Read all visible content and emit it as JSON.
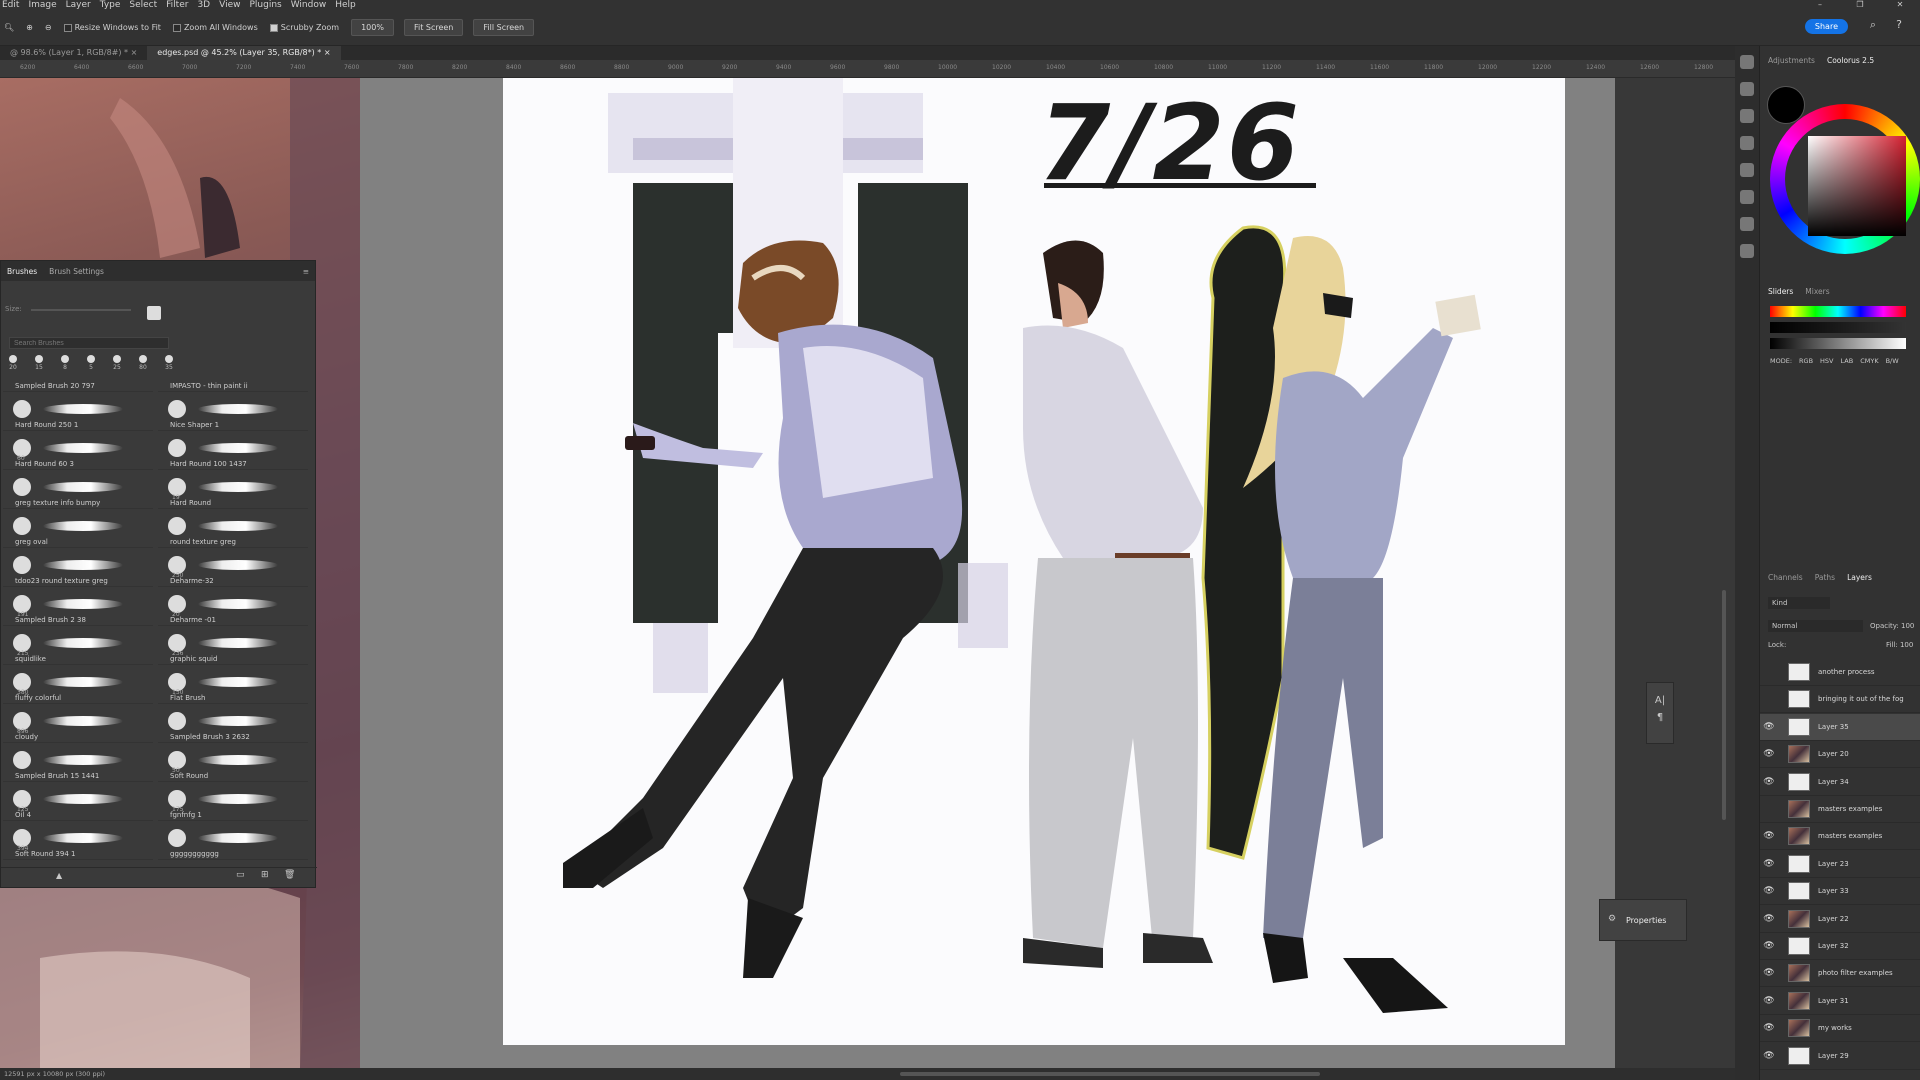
{
  "menubar": {
    "items": [
      "Edit",
      "Image",
      "Layer",
      "Type",
      "Select",
      "Filter",
      "3D",
      "View",
      "Plugins",
      "Window",
      "Help"
    ],
    "window_controls": [
      "–",
      "❐",
      "✕"
    ]
  },
  "options": {
    "resize_windows": "Resize Windows to Fit",
    "zoom_all": "Zoom All Windows",
    "scrubby_zoom": "Scrubby Zoom",
    "zoom_value": "100%",
    "fit_screen": "Fit Screen",
    "fill_screen": "Fill Screen",
    "share": "Share"
  },
  "tabs": [
    {
      "label": "@ 98.6% (Layer 1, RGB/8#) *",
      "close": "×"
    },
    {
      "label": "edges.psd @ 45.2% (Layer 35, RGB/8*) *",
      "close": "×"
    }
  ],
  "ruler": [
    "6200",
    "6400",
    "6600",
    "7000",
    "7200",
    "7400",
    "7600",
    "7800",
    "8200",
    "8400",
    "8600",
    "8800",
    "9000",
    "9200",
    "9400",
    "9600",
    "9800",
    "10000",
    "10200",
    "10400",
    "10600",
    "10800",
    "11000",
    "11200",
    "11400",
    "11600",
    "11800",
    "12000",
    "12200",
    "12400",
    "12600",
    "12800"
  ],
  "artwork": {
    "date": "7/26"
  },
  "brushes": {
    "tabs": [
      "Brushes",
      "Brush Settings"
    ],
    "search_placeholder": "Search Brushes",
    "size_label": "Size:",
    "preset_sizes": [
      "20",
      "15",
      "8",
      "5",
      "25",
      "80",
      "35"
    ],
    "items": [
      {
        "name": "Sampled Brush 20 797",
        "size": ""
      },
      {
        "name": "IMPASTO - thin paint ii",
        "size": ""
      },
      {
        "name": "Hard Round 250 1",
        "size": ""
      },
      {
        "name": "Nice Shaper 1",
        "size": ""
      },
      {
        "name": "Hard Round 60 3",
        "size": "60"
      },
      {
        "name": "Hard Round 100 1437",
        "size": ""
      },
      {
        "name": "greg texture info bumpy",
        "size": ""
      },
      {
        "name": "Hard Round",
        "size": "19"
      },
      {
        "name": "greg oval",
        "size": ""
      },
      {
        "name": "round texture greg",
        "size": ""
      },
      {
        "name": "tdoo23 round texture greg",
        "size": ""
      },
      {
        "name": "Deharme-32",
        "size": "250"
      },
      {
        "name": "Sampled Brush 2 38",
        "size": "191"
      },
      {
        "name": "Deharme -01",
        "size": "20"
      },
      {
        "name": "squidlike",
        "size": "215"
      },
      {
        "name": "graphic squid",
        "size": "236"
      },
      {
        "name": "fluffy colorful",
        "size": "380"
      },
      {
        "name": "Flat Brush",
        "size": "150"
      },
      {
        "name": "cloudy",
        "size": "896"
      },
      {
        "name": "Sampled Brush 3 2632",
        "size": ""
      },
      {
        "name": "Sampled Brush 15 1441",
        "size": ""
      },
      {
        "name": "Soft Round",
        "size": "50"
      },
      {
        "name": "Oil 4",
        "size": "125"
      },
      {
        "name": "fgnfnfg 1",
        "size": "175"
      },
      {
        "name": "Soft Round 394 1",
        "size": "394"
      },
      {
        "name": "ggggggggggg",
        "size": ""
      }
    ]
  },
  "right_panel": {
    "top_tabs": [
      "Adjustments",
      "Coolorus 2.5"
    ],
    "slider_tabs": [
      "Sliders",
      "Mixers"
    ],
    "modes": [
      "MODE:",
      "RGB",
      "HSV",
      "LAB",
      "CMYK",
      "B/W"
    ],
    "layer_tabs": [
      "Channels",
      "Paths",
      "Layers"
    ],
    "kind": "Kind",
    "blend_mode": "Normal",
    "opacity_label": "Opacity:",
    "opacity_value": "100",
    "lock_label": "Lock:",
    "fill_label": "Fill:",
    "fill_value": "100",
    "layers": [
      {
        "name": "another process",
        "visible": false,
        "thumb": "blank"
      },
      {
        "name": "bringing it out of the fog",
        "visible": false,
        "thumb": "blank"
      },
      {
        "name": "Layer 35",
        "visible": true,
        "thumb": "blank",
        "selected": true
      },
      {
        "name": "Layer 20",
        "visible": true,
        "thumb": "pic"
      },
      {
        "name": "Layer 34",
        "visible": true,
        "thumb": "blank"
      },
      {
        "name": "masters examples",
        "visible": false,
        "thumb": "pic"
      },
      {
        "name": "masters examples",
        "visible": true,
        "thumb": "pic"
      },
      {
        "name": "Layer 23",
        "visible": true,
        "thumb": "blank"
      },
      {
        "name": "Layer 33",
        "visible": true,
        "thumb": "blank"
      },
      {
        "name": "Layer 22",
        "visible": true,
        "thumb": "pic"
      },
      {
        "name": "Layer 32",
        "visible": true,
        "thumb": "blank"
      },
      {
        "name": "photo filter examples",
        "visible": true,
        "thumb": "pic"
      },
      {
        "name": "Layer 31",
        "visible": true,
        "thumb": "pic"
      },
      {
        "name": "my works",
        "visible": true,
        "thumb": "pic"
      },
      {
        "name": "Layer 29",
        "visible": true,
        "thumb": "blank"
      }
    ]
  },
  "properties": {
    "label": "Properties"
  },
  "status": {
    "text": "12591 px x 10080 px (300 ppi)"
  }
}
